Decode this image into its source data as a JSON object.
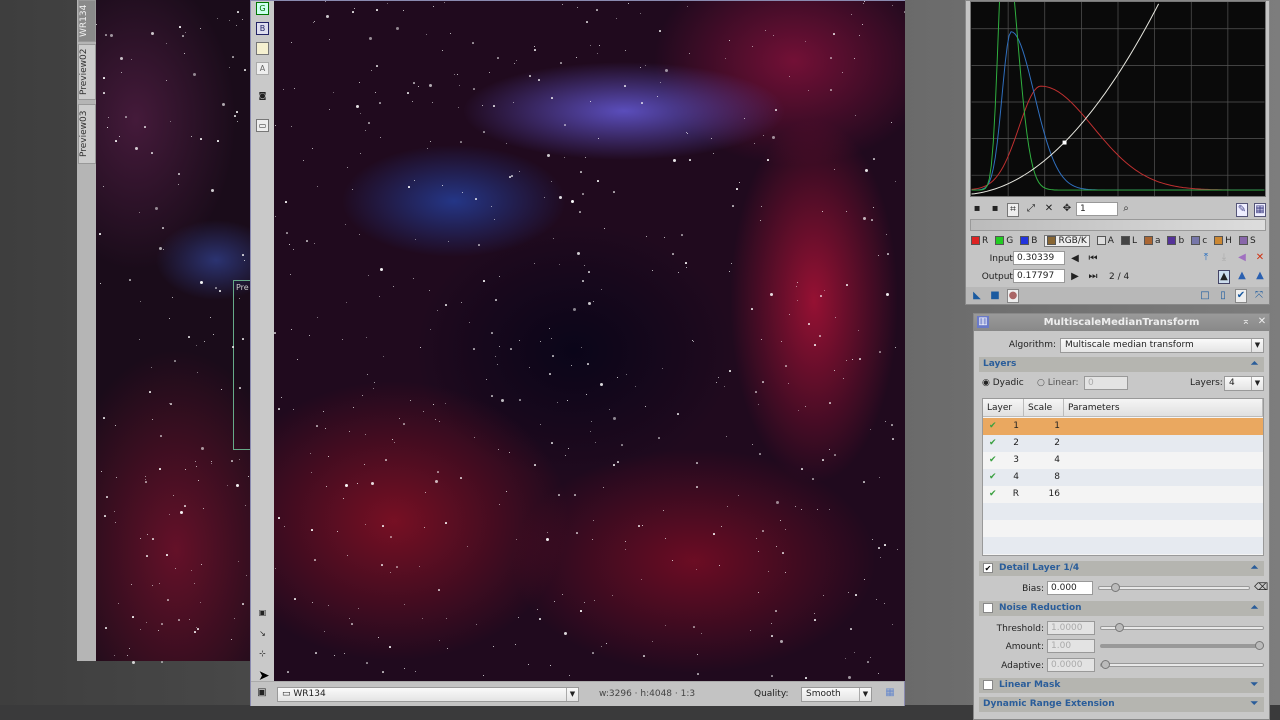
{
  "back_window": {
    "tabs": [
      "WR134",
      "Preview02",
      "Preview03"
    ],
    "preview_label": "Pre"
  },
  "main_window": {
    "toolbar": [
      "G",
      "B",
      "",
      "A"
    ],
    "view_selector": "WR134",
    "image_info": "w:3296 · h:4048 · 1:3",
    "quality_label": "Quality:",
    "quality_value": "Smooth"
  },
  "curves": {
    "zoom_value": "1",
    "channels": [
      {
        "label": "R",
        "color": "#dd2222"
      },
      {
        "label": "G",
        "color": "#22cc22"
      },
      {
        "label": "B",
        "color": "#2233dd"
      },
      {
        "label": "RGB/K",
        "color": "#886633"
      },
      {
        "label": "A",
        "color": "#dddddd"
      },
      {
        "label": "L",
        "color": "#444444"
      },
      {
        "label": "a",
        "color": "#aa6633"
      },
      {
        "label": "b",
        "color": "#553399"
      },
      {
        "label": "c",
        "color": "#7777aa"
      },
      {
        "label": "H",
        "color": "#cc8833"
      },
      {
        "label": "S",
        "color": "#8866aa"
      }
    ],
    "selected_channel": "RGB/K",
    "input_label": "Input:",
    "input_value": "0.30339",
    "output_label": "Output:",
    "output_value": "0.17797",
    "point_counter": "2 / 4",
    "colors": {
      "red": "#c03030",
      "green": "#30b040",
      "blue": "#3070c0",
      "curve": "#e8e8e0"
    }
  },
  "mmt": {
    "title": "MultiscaleMedianTransform",
    "algorithm_label": "Algorithm:",
    "algorithm_value": "Multiscale median transform",
    "layers_section": "Layers",
    "dyadic_label": "Dyadic",
    "linear_label": "Linear:",
    "linear_value": "0",
    "layers_label": "Layers:",
    "layers_value": "4",
    "table": {
      "headers": [
        "Layer",
        "Scale",
        "Parameters"
      ],
      "rows": [
        {
          "layer": "1",
          "scale": "1"
        },
        {
          "layer": "2",
          "scale": "2"
        },
        {
          "layer": "3",
          "scale": "4"
        },
        {
          "layer": "4",
          "scale": "8"
        },
        {
          "layer": "R",
          "scale": "16"
        }
      ]
    },
    "detail_section": "Detail Layer 1/4",
    "bias_label": "Bias:",
    "bias_value": "0.000",
    "noise_section": "Noise Reduction",
    "threshold_label": "Threshold:",
    "threshold_value": "1.0000",
    "amount_label": "Amount:",
    "amount_value": "1.00",
    "adaptive_label": "Adaptive:",
    "adaptive_value": "0.0000",
    "linear_mask_section": "Linear Mask",
    "dre_section": "Dynamic Range Extension",
    "selection_color": "#eaa860"
  }
}
